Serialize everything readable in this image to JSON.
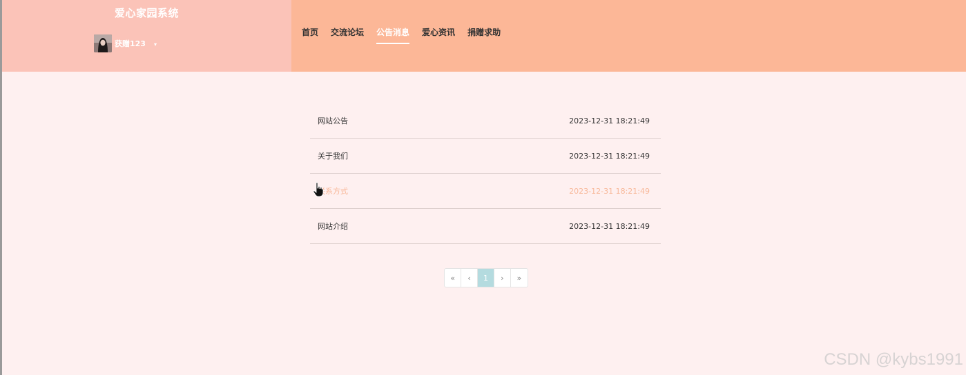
{
  "header": {
    "site_title": "爱心家园系统",
    "user": {
      "name": "获赠123",
      "caret": "▾"
    },
    "nav": [
      {
        "label": "首页"
      },
      {
        "label": "交流论坛"
      },
      {
        "label": "公告消息"
      },
      {
        "label": "爱心资讯"
      },
      {
        "label": "捐赠求助"
      }
    ],
    "active_nav": "公告消息"
  },
  "notices": [
    {
      "title": "网站公告",
      "time": "2023-12-31 18:21:49"
    },
    {
      "title": "关于我们",
      "time": "2023-12-31 18:21:49"
    },
    {
      "title": "联系方式",
      "time": "2023-12-31 18:21:49"
    },
    {
      "title": "网站介绍",
      "time": "2023-12-31 18:21:49"
    }
  ],
  "pagination": {
    "first": "«",
    "prev": "‹",
    "current": "1",
    "next": "›",
    "last": "»"
  },
  "colors": {
    "header_bg": "#fcb797",
    "brand_bg": "#fbc3b8",
    "page_bg": "#fef0f0",
    "hover_text": "#f8b899",
    "page_active": "#b4dbdf"
  },
  "watermark": "CSDN @kybs1991"
}
